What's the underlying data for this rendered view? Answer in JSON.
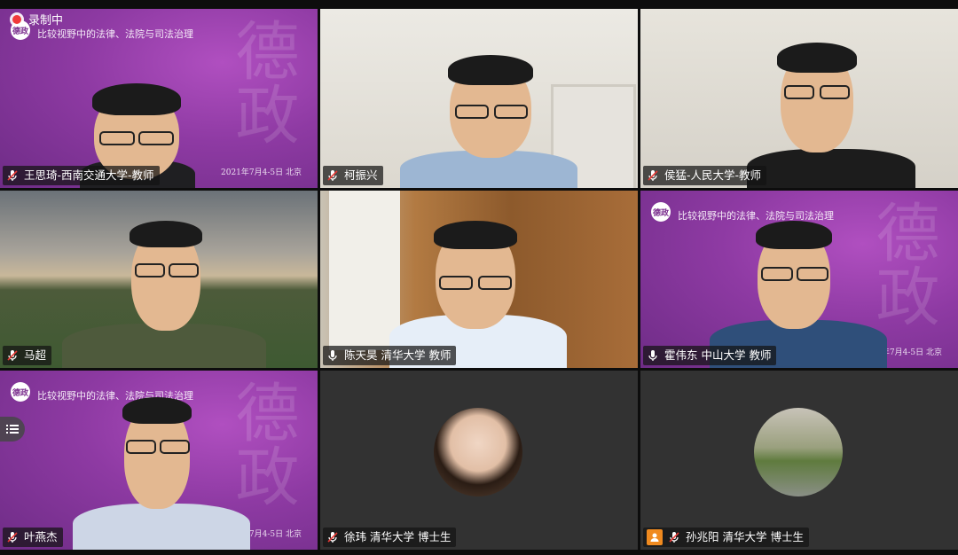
{
  "recording": {
    "text": "录制中"
  },
  "conference": {
    "topic": "比较视野中的法律、法院与司法治理",
    "logo_text": "德政",
    "calligraphy": "德政",
    "date": "2021年7月4-5日 北京",
    "date_partial_a": "21年7月4-5日 北京",
    "date_partial_b": "1年7月4-5日 北京"
  },
  "participants": [
    {
      "name": "王思琦-西南交通大学-教师"
    },
    {
      "name": "柯振兴"
    },
    {
      "name": "侯猛-人民大学-教师"
    },
    {
      "name": "马超"
    },
    {
      "name": "陈天昊 清华大学 教师"
    },
    {
      "name": "霍伟东 中山大学 教师"
    },
    {
      "name": "叶燕杰"
    },
    {
      "name": "徐玮 清华大学 博士生"
    },
    {
      "name": "孙兆阳 清华大学 博士生"
    }
  ],
  "icons": {
    "mic": "microphone-icon",
    "list": "list-icon",
    "person": "person-icon"
  }
}
